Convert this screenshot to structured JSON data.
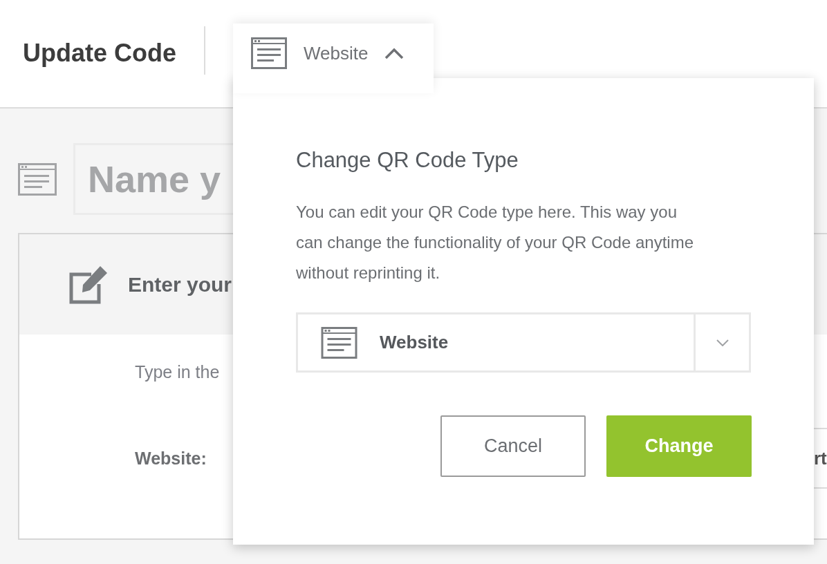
{
  "header": {
    "title": "Update Code",
    "type_selector": {
      "label": "Website",
      "expanded": true
    }
  },
  "name_field": {
    "placeholder": "Name y"
  },
  "card": {
    "title": "Enter your",
    "hint": "Type in the",
    "website_label": "Website:",
    "website_value": "rt"
  },
  "popover": {
    "title": "Change QR Code Type",
    "description": "You can edit your QR Code type here. This way you can change the functionality of your QR Code anytime without reprinting it.",
    "select": {
      "value": "Website"
    },
    "buttons": [
      {
        "label": "Cancel",
        "kind": "secondary"
      },
      {
        "label": "Change",
        "kind": "primary"
      }
    ]
  }
}
